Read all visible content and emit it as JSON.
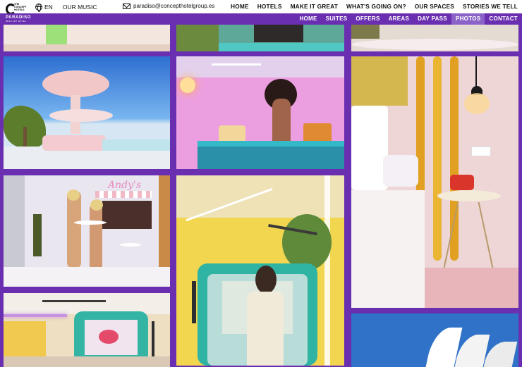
{
  "brand": {
    "line1": "THE",
    "line2": "CONCEPT",
    "line3": "HOTELS"
  },
  "topbar": {
    "lang": "EN",
    "music": "OUR MUSIC",
    "email": "paradiso@concepthotelgroup.es",
    "nav": [
      "HOME",
      "HOTELS",
      "MAKE IT GREAT",
      "WHAT'S GOING ON?",
      "OUR SPACES",
      "STORIES WE TELL"
    ]
  },
  "subbar": {
    "logo": "PARADISO",
    "logo_sub": "IBIZA ART HOTEL",
    "nav": [
      "HOME",
      "SUITES",
      "OFFERS",
      "AREAS",
      "DAY PASS",
      "PHOTOS",
      "CONTACT"
    ],
    "active": "PHOTOS"
  },
  "colors": {
    "brand_purple": "#6a2fb0",
    "active_tab": "#8b63c8",
    "topbar_bg": "#ffffff"
  },
  "gallery": {
    "sign_text": "Andy's",
    "alt_names": [
      "pool-with-pink-umbrella",
      "woman-at-pink-bar",
      "bedroom-with-wavy-headboard",
      "pool-bar-two-women",
      "woman-in-yellow-room",
      "suite-with-wavy-mirror",
      "sky-sculpture"
    ]
  }
}
